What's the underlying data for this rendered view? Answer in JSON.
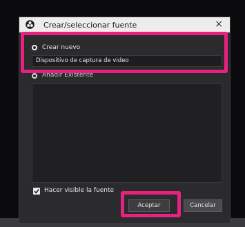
{
  "dialog": {
    "title": "Crear/seleccionar fuente",
    "close_label": "×"
  },
  "options": {
    "create_new_label": "Crear nuevo",
    "add_existing_label": "Añadir Existente",
    "name_value": "Dispositivo de captura de video"
  },
  "visibility": {
    "label": "Hacer visible la fuente",
    "checked": true
  },
  "buttons": {
    "ok_label": "Aceptar",
    "cancel_label": "Cancelar"
  },
  "colors": {
    "highlight": "#e6217f",
    "dialog_bg": "#2b2b2e"
  }
}
